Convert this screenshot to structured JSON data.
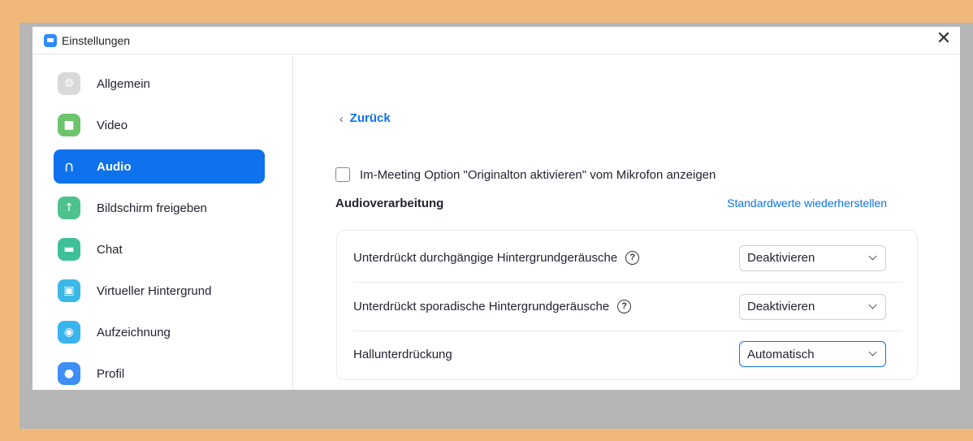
{
  "window": {
    "title": "Einstellungen",
    "close_glyph": "✕"
  },
  "sidebar": {
    "items": [
      {
        "label": "Allgemein",
        "icon": "gear-icon",
        "color": "#d9d9d9",
        "glyph": "⚙"
      },
      {
        "label": "Video",
        "icon": "video-camera-icon",
        "color": "#6cc46b",
        "glyph": "■"
      },
      {
        "label": "Audio",
        "icon": "headphones-icon",
        "color": "#0e72ed",
        "glyph": "∩",
        "active": true
      },
      {
        "label": "Bildschirm freigeben",
        "icon": "share-screen-icon",
        "color": "#4dc28d",
        "glyph": "↑"
      },
      {
        "label": "Chat",
        "icon": "chat-icon",
        "color": "#3ec19b",
        "glyph": "▬"
      },
      {
        "label": "Virtueller Hintergrund",
        "icon": "virtual-background-icon",
        "color": "#3cb8e6",
        "glyph": "▣"
      },
      {
        "label": "Aufzeichnung",
        "icon": "record-icon",
        "color": "#38b4ef",
        "glyph": "◉"
      },
      {
        "label": "Profil",
        "icon": "profile-icon",
        "color": "#3d8ef5",
        "glyph": "●"
      }
    ]
  },
  "content": {
    "back_label": "Zurück",
    "back_chevron": "‹",
    "checkbox_label": "Im-Meeting Option \"Originalton aktivieren\" vom Mikrofon anzeigen",
    "checkbox_checked": false,
    "section_title": "Audioverarbeitung",
    "restore_label": "Standardwerte wiederherstellen",
    "help_glyph": "?",
    "rows": [
      {
        "label": "Unterdrückt durchgängige Hintergrundgeräusche",
        "help": true,
        "value": "Deaktivieren"
      },
      {
        "label": "Unterdrückt sporadische Hintergrundgeräusche",
        "help": true,
        "value": "Deaktivieren"
      },
      {
        "label": "Hallunterdrückung",
        "help": false,
        "value": "Automatisch"
      }
    ]
  },
  "colors": {
    "accent": "#0e72ed",
    "frame": "#f0b97a",
    "backdrop": "#b6b6b6"
  }
}
